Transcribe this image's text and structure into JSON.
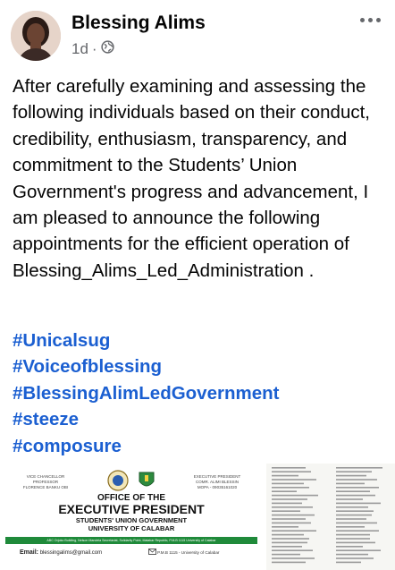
{
  "post": {
    "author": "Blessing Alims",
    "time": "1d",
    "separator": "·",
    "privacy_icon": "globe-icon",
    "more_icon": "more-horizontal-icon",
    "body": "After carefully examining and assessing the following individuals based on their conduct, credibility, enthusiasm, transparency, and commitment to the Students’ Union Government's progress and advancement, I  am pleased to announce the following appointments for the efficient operation of Blessing_Alims_Led_Administration .",
    "hashtags": [
      "#Unicalsug",
      "#Voiceofblessing",
      "#BlessingAlimLedGovernment",
      "#steeze",
      "#composure"
    ]
  },
  "letterhead": {
    "left_title": "VICE CHANCELLOR",
    "left_role": "PROFESSOR",
    "left_name": "FLORENCE BANKU OBI",
    "right_title": "EXECUTIVE PRESIDENT",
    "right_name": "COMR. ALIMI BLESSIN",
    "right_phone": "MOPA - 09035161020",
    "office": "OFFICE OF THE",
    "title": "EXECUTIVE PRESIDENT",
    "sug": "STUDENTS' UNION GOVERNMENT",
    "university": "UNIVERSITY OF CALABAR",
    "address": "ABC Orjoko Building, Nelson Mandela Secretariat, Solidarity Point, Malabar Republic, P.M.B 1115 University of Calabar",
    "email_label": "Email:",
    "email": "blessingalims@gmail.com",
    "pmb": "P.M.B 1115 - University of Calabar"
  },
  "colors": {
    "hashtag": "#1b5fd1",
    "muted": "#65676b",
    "green_bar": "#1f8a3a"
  }
}
